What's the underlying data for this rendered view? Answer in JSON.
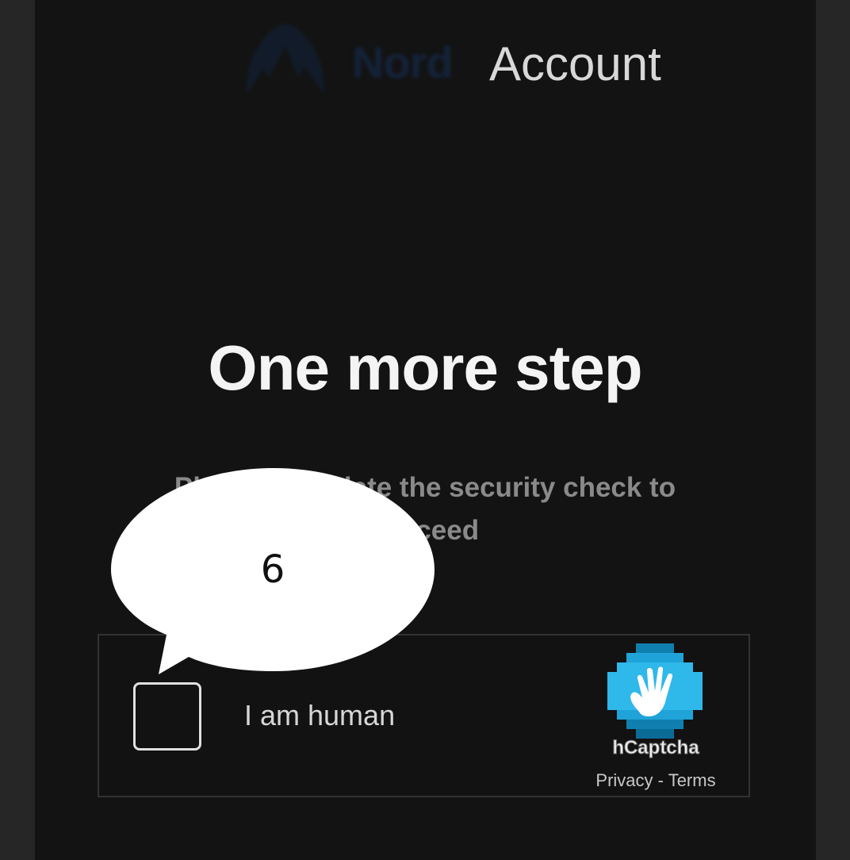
{
  "header": {
    "brand_name": "Nord",
    "product_name": "Account"
  },
  "main": {
    "title": "One more step",
    "subtitle_line1": "Please complete the security check to",
    "subtitle_line2": "proceed"
  },
  "captcha": {
    "checkbox_label": "I am human",
    "provider": "hCaptcha",
    "privacy_link": "Privacy",
    "separator": " - ",
    "terms_link": "Terms",
    "checked": false
  },
  "annotation": {
    "label": "6"
  },
  "colors": {
    "page_bg": "#131313",
    "side_bg": "#262626",
    "text_primary": "#f4f4f4",
    "text_secondary": "#8a8a8a",
    "hcaptcha_blue": "#1fb5e6"
  },
  "icons": {
    "brand_logo": "nord-mountain-icon",
    "captcha_logo": "hcaptcha-hand-icon"
  }
}
